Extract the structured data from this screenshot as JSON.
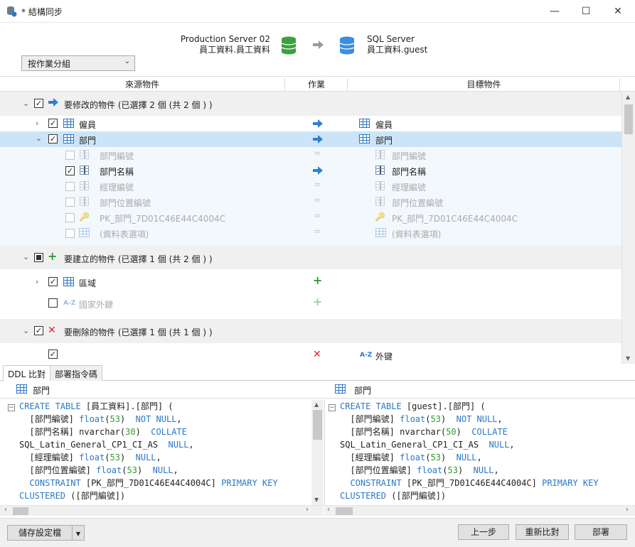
{
  "window": {
    "title": "* 結構同步",
    "minimize": "—",
    "maximize": "☐",
    "close": "✕"
  },
  "source": {
    "server": "Production Server 02",
    "db": "員工資料.員工資料"
  },
  "target": {
    "server": "SQL Server",
    "db": "員工資料.guest"
  },
  "group_select": {
    "value": "按作業分組"
  },
  "columns": {
    "source": "來源物件",
    "action": "作業",
    "target": "目標物件"
  },
  "groups": {
    "modify": "要修改的物件 (已選擇 2 個 (共 2 個 ) )",
    "create": "要建立的物件 (已選擇 1 個 (共 2 個 ) )",
    "delete": "要刪除的物件 (已選擇 1 個 (共 1 個 ) )"
  },
  "modify_items": {
    "employee": {
      "source": "僱員",
      "target": "僱員"
    },
    "dept": {
      "source": "部門",
      "target": "部門"
    }
  },
  "dept_children": [
    {
      "source": "部門編號",
      "target": "部門編號"
    },
    {
      "source": "部門名稱",
      "target": "部門名稱"
    },
    {
      "source": "經理編號",
      "target": "經理編號"
    },
    {
      "source": "部門位置編號",
      "target": "部門位置編號"
    },
    {
      "source": "PK_部門_7D01C46E44C4004C",
      "target": "PK_部門_7D01C46E44C4004C"
    },
    {
      "source": "(資料表選項)",
      "target": "(資料表選項)"
    }
  ],
  "create_items": [
    {
      "source": "區域"
    },
    {
      "source": "國家外鍵"
    }
  ],
  "delete_items": [
    {
      "target": "外键"
    }
  ],
  "icons": {
    "az": "A-Z"
  },
  "tabs": {
    "ddl": "DDL 比對",
    "deploy": "部署指令碼"
  },
  "ddl": {
    "left_title": "部門",
    "right_title": "部門"
  },
  "footer": {
    "save_profile": "儲存設定檔",
    "prev": "上一步",
    "recompare": "重新比對",
    "deploy": "部署"
  },
  "colors": {
    "accent": "#2b78c5",
    "selected_row": "#cce4f7",
    "green": "#2e9e2e",
    "red": "#d9272e"
  }
}
